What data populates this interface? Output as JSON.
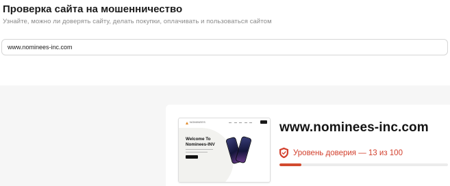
{
  "header": {
    "title": "Проверка сайта на мошенничество",
    "subtitle": "Узнайте, можно ли доверять сайту, делать покупки, оплачивать и пользоваться сайтом"
  },
  "search": {
    "value": "www.nominees-inc.com"
  },
  "result": {
    "domain": "www.nominees-inc.com",
    "trust_label": "Уровень доверия — 13 из 100",
    "trust_score": 13,
    "trust_max": 100,
    "preview": {
      "logo_text": "NOMINEES",
      "heading_line1": "Welcome To",
      "heading_line2": "Nominees-INV"
    }
  },
  "colors": {
    "warning": "#d23f2c",
    "bar_fill": "#d24b2f",
    "bar_track": "#ececec",
    "section_bg": "#f6f6f6"
  },
  "icons": {
    "trust": "shield-check-icon"
  }
}
